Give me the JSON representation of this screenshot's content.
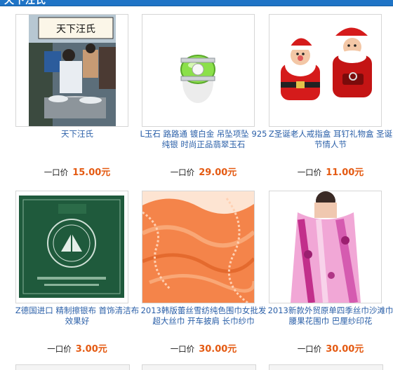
{
  "section": {
    "title": "天下汪氏"
  },
  "products": [
    {
      "title": "天下汪氏",
      "price_label": "一口价",
      "price": "15.00元",
      "image": "street-stall-photo-with-sign"
    },
    {
      "title": "L玉石 路路通 镀白金 吊坠项坠 925纯银 时尚正品翡翠玉石",
      "price_label": "一口价",
      "price": "29.00元",
      "image": "green-jade-bead-pendant"
    },
    {
      "title": "Z圣诞老人戒指盒 耳钉礼物盒 圣诞节情人节",
      "price_label": "一口价",
      "price": "11.00元",
      "image": "santa-claus-ring-box"
    },
    {
      "title": "Z德国进口 精制擦银布 首饰清洁布 效果好",
      "price_label": "一口价",
      "price": "3.00元",
      "image": "green-silver-polishing-cloth-box"
    },
    {
      "title": "2013韩版蕾丝雪纺纯色围巾女批发 超大丝巾 开车披肩 长巾纱巾",
      "price_label": "一口价",
      "price": "30.00元",
      "image": "orange-chiffon-lace-scarf"
    },
    {
      "title": "2013新款外贸原单四季丝巾沙滩巾 腰果花围巾 巴厘纱印花",
      "price_label": "一口价",
      "price": "30.00元",
      "image": "pink-paisley-silk-scarf-on-model"
    }
  ],
  "colors": {
    "header": "#1f74c6",
    "link": "#2a5fa8",
    "price": "#e45a12",
    "border": "#d6d6d6"
  }
}
